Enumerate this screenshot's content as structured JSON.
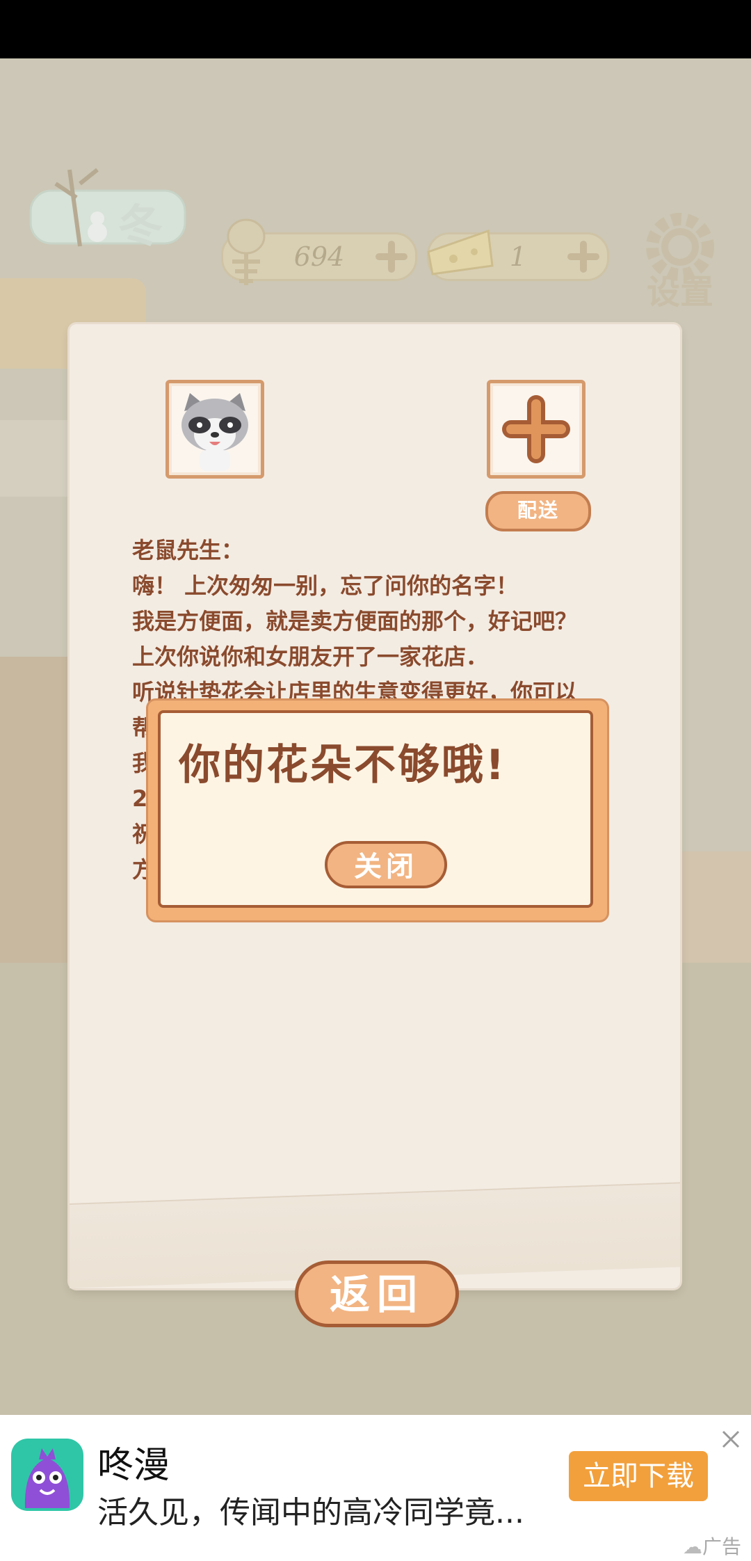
{
  "hud": {
    "season_label": "冬",
    "fish_count": "694",
    "cheese_count": "1",
    "settings_label": "设置"
  },
  "letter": {
    "deliver_label": "配送",
    "lines": [
      "老鼠先生：",
      "嗨！ 上次匆匆一别，忘了问你的名字！",
      "我是方便面，就是卖方便面的那个，好记吧？",
      "上次你说你和女朋友开了一家花店．",
      "听说针垫花会让店里的生意变得更好，你可以",
      "帮",
      "我",
      "2",
      "祝",
      "方"
    ]
  },
  "popup": {
    "message": "你的花朵不够哦!",
    "close_label": "关闭"
  },
  "back_label": "返回",
  "ad": {
    "title": "咚漫",
    "description": "活久见，传闻中的高冷同学竟...",
    "download_label": "立即下载",
    "tag": "广告"
  },
  "colors": {
    "accent_orange": "#f2b482",
    "border_brown": "#a65d35",
    "text_brown": "#8a4a2d",
    "ad_button": "#f2a03c"
  }
}
